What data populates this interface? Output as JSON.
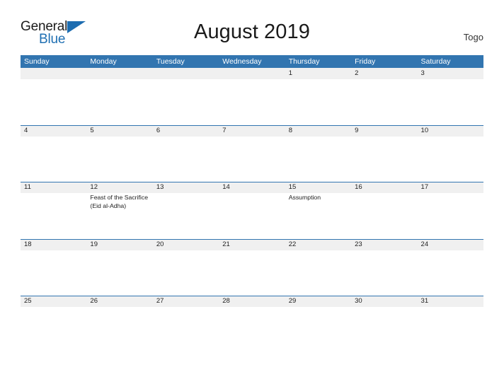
{
  "brand": {
    "name_part1": "General",
    "name_part2": "Blue",
    "flag_icon": "blue-triangle-flag-icon"
  },
  "header": {
    "title": "August 2019",
    "locale": "Togo"
  },
  "colors": {
    "header_blue": "#3275b0",
    "band_gray": "#f0f0f0",
    "brand_blue": "#1f6fb2",
    "text": "#222222"
  },
  "calendar": {
    "day_headers": [
      "Sunday",
      "Monday",
      "Tuesday",
      "Wednesday",
      "Thursday",
      "Friday",
      "Saturday"
    ],
    "weeks": [
      {
        "days": [
          {
            "num": "",
            "events": []
          },
          {
            "num": "",
            "events": []
          },
          {
            "num": "",
            "events": []
          },
          {
            "num": "",
            "events": []
          },
          {
            "num": "1",
            "events": []
          },
          {
            "num": "2",
            "events": []
          },
          {
            "num": "3",
            "events": []
          }
        ]
      },
      {
        "days": [
          {
            "num": "4",
            "events": []
          },
          {
            "num": "5",
            "events": []
          },
          {
            "num": "6",
            "events": []
          },
          {
            "num": "7",
            "events": []
          },
          {
            "num": "8",
            "events": []
          },
          {
            "num": "9",
            "events": []
          },
          {
            "num": "10",
            "events": []
          }
        ]
      },
      {
        "days": [
          {
            "num": "11",
            "events": []
          },
          {
            "num": "12",
            "events": [
              "Feast of the Sacrifice (Eid al-Adha)"
            ]
          },
          {
            "num": "13",
            "events": []
          },
          {
            "num": "14",
            "events": []
          },
          {
            "num": "15",
            "events": [
              "Assumption"
            ]
          },
          {
            "num": "16",
            "events": []
          },
          {
            "num": "17",
            "events": []
          }
        ]
      },
      {
        "days": [
          {
            "num": "18",
            "events": []
          },
          {
            "num": "19",
            "events": []
          },
          {
            "num": "20",
            "events": []
          },
          {
            "num": "21",
            "events": []
          },
          {
            "num": "22",
            "events": []
          },
          {
            "num": "23",
            "events": []
          },
          {
            "num": "24",
            "events": []
          }
        ]
      },
      {
        "days": [
          {
            "num": "25",
            "events": []
          },
          {
            "num": "26",
            "events": []
          },
          {
            "num": "27",
            "events": []
          },
          {
            "num": "28",
            "events": []
          },
          {
            "num": "29",
            "events": []
          },
          {
            "num": "30",
            "events": []
          },
          {
            "num": "31",
            "events": []
          }
        ]
      }
    ]
  }
}
